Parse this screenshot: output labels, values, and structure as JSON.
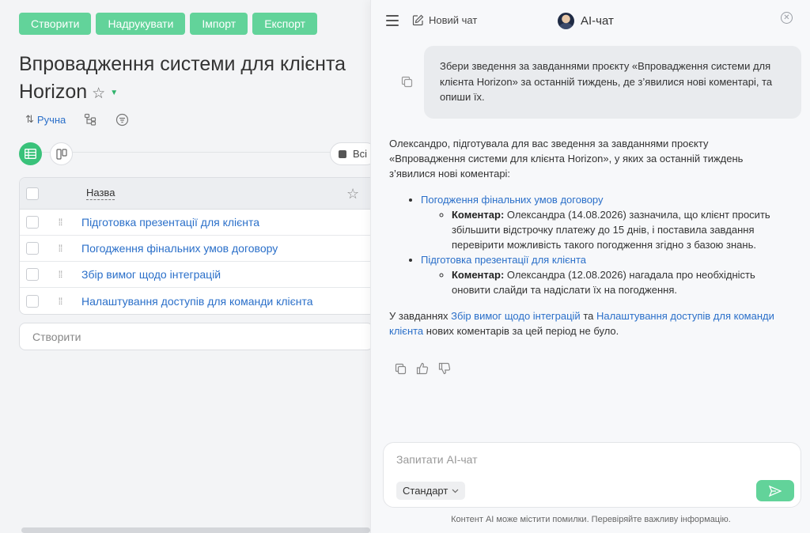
{
  "toolbar": {
    "create": "Створити",
    "print": "Надрукувати",
    "import": "Імпорт",
    "export": "Експорт"
  },
  "page": {
    "title_line1": "Впровадження системи для клієнта",
    "title_line2": "Horizon",
    "sort_label": "Ручна",
    "filter_chip": "Всі"
  },
  "table": {
    "column_name": "Назва",
    "rows": [
      "Підготовка презентації для клієнта",
      "Погодження фінальних умов договору",
      "Збір вимог щодо інтеграцій",
      "Налаштування доступів для команди клієнта"
    ],
    "create_placeholder": "Створити"
  },
  "ai": {
    "new_chat": "Новий чат",
    "title": "AI-чат",
    "user_message": "Збери зведення за завданнями проєкту «Впровадження системи для клієнта Horizon» за останній тиждень, де з’явилися нові коментарі, та опиши їх.",
    "intro": "Олександро, підготувала для вас зведення за завданнями проєкту «Впровадження системи для клієнта Horizon», у яких за останній тиждень з’явилися нові коментарі:",
    "items": [
      {
        "task": "Погодження фінальних умов договору",
        "label": "Коментар:",
        "comment": " Олександра (14.08.2026) зазначила, що клієнт просить збільшити відстрочку платежу до 15 днів, і поставила завдання перевірити можливість такого погодження згідно з базою знань."
      },
      {
        "task": "Підготовка презентації для клієнта",
        "label": "Коментар:",
        "comment": " Олександра (12.08.2026) нагадала про необхідність оновити слайди та надіслати їх на погодження."
      }
    ],
    "outro_prefix": "У завданнях ",
    "outro_link1": "Збір вимог щодо інтеграцій",
    "outro_mid": " та ",
    "outro_link2": "Налаштування доступів для команди клієнта",
    "outro_suffix": " нових коментарів за цей період не було.",
    "input_placeholder": "Запитати AI-чат",
    "mode": "Стандарт",
    "disclaimer": "Контент AI може містити помилки. Перевіряйте важливу інформацію."
  },
  "colors": {
    "accent_green": "#62d39a",
    "link_blue": "#2a6fc9"
  },
  "icons": {
    "star": "star-icon",
    "menu": "hamburger-menu-icon",
    "new_chat": "edit-icon",
    "close": "close-icon",
    "copy": "copy-icon",
    "like": "thumbs-up-icon",
    "dislike": "thumbs-down-icon",
    "send": "send-icon"
  }
}
